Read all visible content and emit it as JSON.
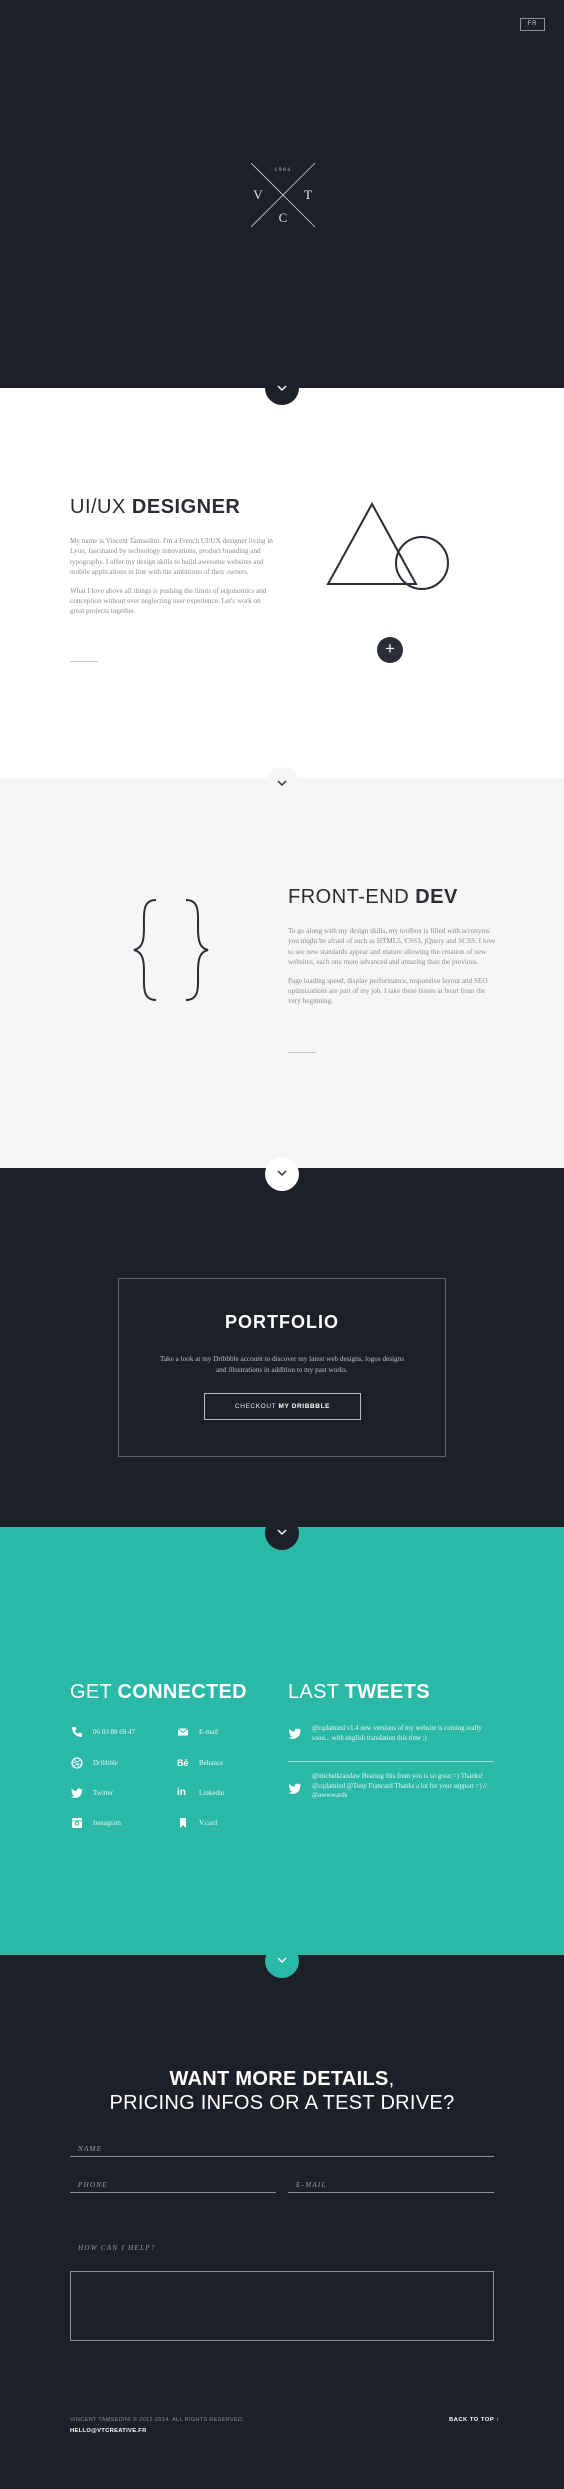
{
  "header": {
    "lang_button": "FR"
  },
  "logo": {
    "year": "1984",
    "letters": [
      "V",
      "T",
      "C"
    ]
  },
  "designer": {
    "title_light": "UI/UX ",
    "title_bold": "DESIGNER",
    "paragraphs": [
      "My name is Vincent Tamsedini. I'm a French UI/UX designer living in Lyon, fascinated by technology innovations, product branding and typography. I offer my design skills to build awesome websites and mobile applications in line with the ambitions of their owners.",
      "What I love above all things is pushing the limits of ergonomics and conception without ever neglecting user experience. Let's work on great projects together."
    ],
    "plus_label": "+"
  },
  "dev": {
    "title_light": "FRONT-END ",
    "title_bold": "DEV",
    "paragraphs": [
      "To go along with my design skills, my toolbox is filled with acronyms you might be afraid of such as HTML5, CSS3, jQuery and SCSS. I love to see new standards appear and mature allowing the creation of new websites, each one more advanced and amazing than the previous.",
      "Page loading speed, display performance, responsive layout and SEO optimizations are part of my job, I take these issues at heart from the very beginning."
    ]
  },
  "portfolio": {
    "title": "PORTFOLIO",
    "text": "Take a look at my Dribbble account to discover my latest web designs, logos designs and illustrations in addition to my past works.",
    "button_light": "CHECKOUT ",
    "button_bold": "MY DRIBBBLE"
  },
  "connected": {
    "title_light": "GET ",
    "title_bold": "CONNECTED",
    "contacts": [
      {
        "icon": "phone-icon",
        "label": "06 03 88 69 47"
      },
      {
        "icon": "mail-icon",
        "label": "E-mail"
      },
      {
        "icon": "dribbble-icon",
        "label": "Dribbble"
      },
      {
        "icon": "behance-icon",
        "label": "Behance"
      },
      {
        "icon": "twitter-icon",
        "label": "Twitter"
      },
      {
        "icon": "linkedin-icon",
        "label": "Linkedin"
      },
      {
        "icon": "instagram-icon",
        "label": "Instagram"
      },
      {
        "icon": "vcard-icon",
        "label": "V.card"
      }
    ]
  },
  "tweets": {
    "title_light": "LAST ",
    "title_bold": "TWEETS",
    "items": [
      "@cqdamind v1.4 new versions of my website is coming really soon... with english translation this time ;)",
      "@michelkrandaw Hearing this from you is so great =) Thanks! @cqdamind @Tony Francard Thanks a lot for your support =) // @awwwards"
    ]
  },
  "contact_form": {
    "title_bold": "WANT MORE DETAILS",
    "title_comma": ",",
    "title_line2": "PRICING INFOS OR A TEST DRIVE?",
    "name_placeholder": "NAME",
    "phone_placeholder": "PHONE",
    "email_placeholder": "E-MAIL",
    "message_label": "HOW CAN I HELP?"
  },
  "footer": {
    "copyright": "VINCENT TAMSEDINI © 2012-2014. ALL RIGHTS RESERVED.",
    "email": "HELLO@VTCREATIVE.FR",
    "back_to_top": "BACK TO TOP ↑"
  },
  "colors": {
    "dark": "#1e2029",
    "teal": "#2ab9a6",
    "light_gray": "#f6f6f6",
    "white": "#ffffff"
  }
}
